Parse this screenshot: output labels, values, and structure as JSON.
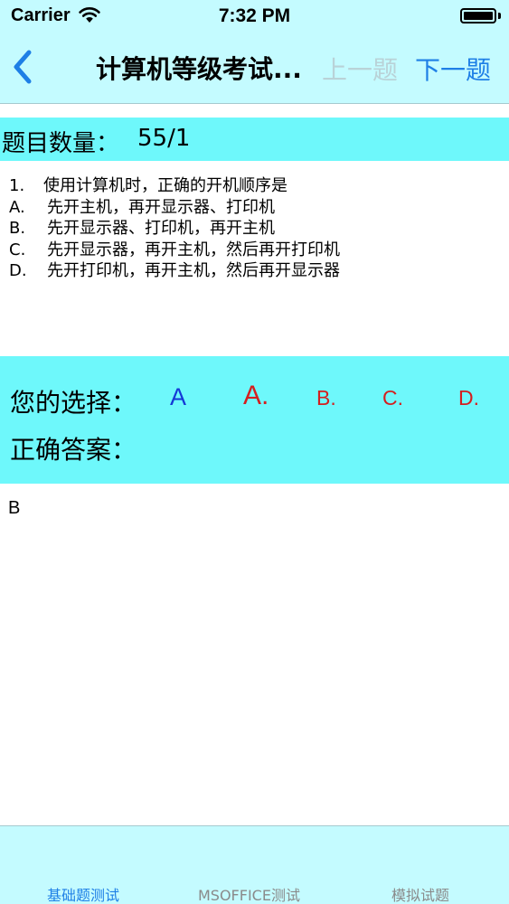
{
  "status_bar": {
    "carrier": "Carrier",
    "time": "7:32 PM",
    "battery_level": 1.0
  },
  "nav": {
    "title": "计算机等级考试...",
    "prev_label": "上一题",
    "next_label": "下一题",
    "back_icon": "chevron-left-icon",
    "accent_color": "#1e7fe6",
    "disabled_color": "#b9d2d7"
  },
  "count": {
    "label": "题目数量：",
    "value": "55/1"
  },
  "question": {
    "number": "1.",
    "text": "使用计算机时，正确的开机顺序是",
    "options": [
      {
        "key": "A.",
        "text": "先开主机，再开显示器、打印机"
      },
      {
        "key": "B.",
        "text": "先开显示器、打印机，再开主机"
      },
      {
        "key": "C.",
        "text": "先开显示器，再开主机，然后再开打印机"
      },
      {
        "key": "D.",
        "text": "先开打印机，再开主机，然后再开显示器"
      }
    ]
  },
  "answer": {
    "choice_label": "您的选择：",
    "correct_label": "正确答案：",
    "selected": "A",
    "buttons": [
      "A.",
      "B.",
      "C.",
      "D."
    ],
    "correct_value": "B",
    "colors": {
      "selected": "#1539d6",
      "option": "#d41f1f",
      "panel": "#6ef8fb"
    }
  },
  "tabs": [
    {
      "label": "基础题测试",
      "active": true
    },
    {
      "label": "MSOFFICE测试",
      "active": false
    },
    {
      "label": "模拟试题",
      "active": false
    }
  ],
  "colors": {
    "bar_background": "#c4fbff",
    "highlight_background": "#6ef8fb"
  }
}
